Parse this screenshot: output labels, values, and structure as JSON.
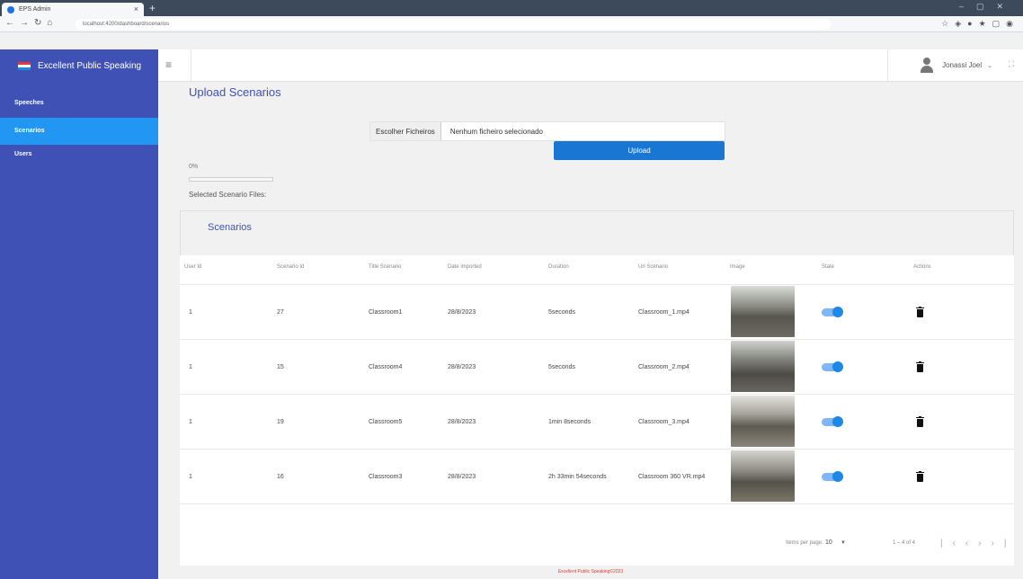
{
  "browser": {
    "tab_title": "EPS Admin",
    "url": "localhost:4200/dashboard/scenarios"
  },
  "brand": {
    "title": "Excellent Public Speaking"
  },
  "sidebar": {
    "items": [
      {
        "label": "Speeches",
        "active": false
      },
      {
        "label": "Scenarios",
        "active": true
      },
      {
        "label": "Users",
        "active": false
      }
    ]
  },
  "topbar": {
    "user_name": "Jonassi Joel"
  },
  "upload": {
    "title": "Upload Scenarios",
    "choose_label": "Escolher Ficheiros",
    "no_file_text": "Nenhum ficheiro selecionado",
    "button_label": "Upload",
    "progress_text": "0%",
    "progress": 0,
    "selected_label": "Selected Scenario Files:"
  },
  "scenarios": {
    "title": "Scenarios",
    "columns": [
      "User Id",
      "Scenario Id",
      "Title Scenario",
      "Date imported",
      "Duration",
      "Url Scenario",
      "Image",
      "State",
      "Actions"
    ],
    "rows": [
      {
        "user_id": "1",
        "scenario_id": "27",
        "title": "Classroom1",
        "date": "28/8/2023",
        "duration": "5seconds",
        "url": "Classroom_1.mp4",
        "state": true
      },
      {
        "user_id": "1",
        "scenario_id": "15",
        "title": "Classroom4",
        "date": "28/8/2023",
        "duration": "5seconds",
        "url": "Classroom_2.mp4",
        "state": true
      },
      {
        "user_id": "1",
        "scenario_id": "19",
        "title": "Classroom5",
        "date": "28/8/2023",
        "duration": "1min 8seconds",
        "url": "Classroom_3.mp4",
        "state": true
      },
      {
        "user_id": "1",
        "scenario_id": "16",
        "title": "Classroom3",
        "date": "28/8/2023",
        "duration": "2h 33min 54seconds",
        "url": "Classroom 360 VR.mp4",
        "state": true
      }
    ]
  },
  "paginator": {
    "items_per_page_label": "Items per page:",
    "page_size": "10",
    "range_label": "1 – 4 of 4"
  },
  "footer": {
    "text": "Excellent Public Speaking©2023"
  }
}
